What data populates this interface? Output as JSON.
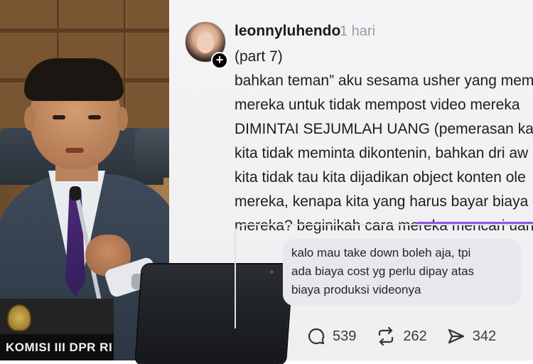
{
  "photo": {
    "nameplate": "KOMISI III DPR RI"
  },
  "post": {
    "username": "leonnyluhendo",
    "time": "1 hari",
    "lines": [
      "(part 7)",
      "bahkan teman” aku sesama usher yang mem",
      "mereka untuk tidak mempost video mereka",
      "DIMINTAI SEJUMLAH UANG (pemerasan kal",
      "kita tidak meminta dikontenin, bahkan dri aw",
      "kita tidak tau kita dijadikan object konten ole",
      "mereka, kenapa kita yang harus bayar biaya",
      "mereka? beginikah cara mereka mencari uan"
    ],
    "quote": {
      "lines": [
        "kalo mau take down boleh aja, tpi",
        "ada biaya cost yg perlu dipay atas",
        "biaya produksi videonya"
      ]
    },
    "actions": {
      "replies": "539",
      "reposts": "262",
      "shares": "342"
    },
    "icons": {
      "reply": "speech-bubble-icon",
      "repost": "repost-arrows-icon",
      "share": "send-icon",
      "follow": "plus-icon"
    },
    "colors": {
      "accent": "#8b55e8",
      "text": "#1d1d1f",
      "muted": "#9a9aa2"
    }
  }
}
